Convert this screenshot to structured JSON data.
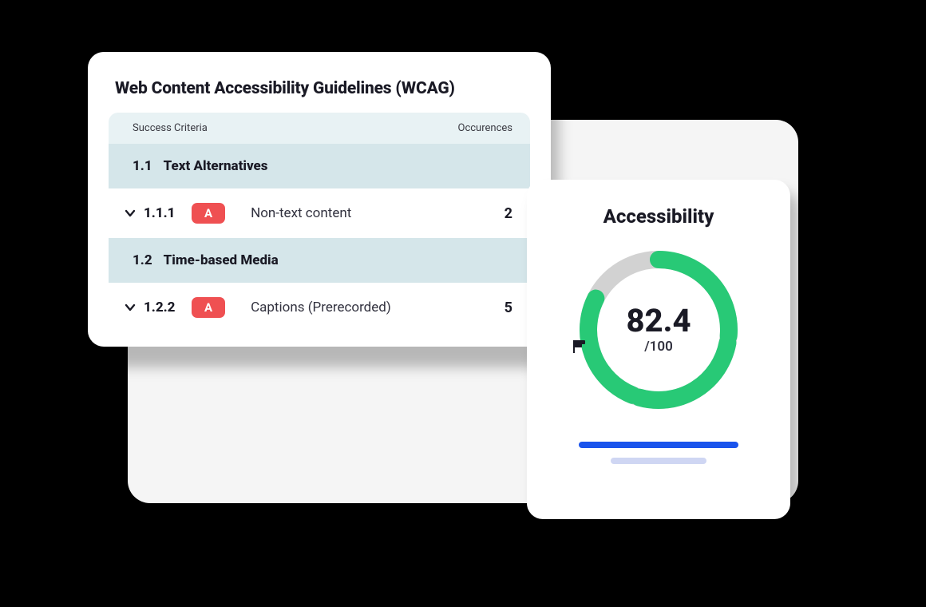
{
  "wcag": {
    "title": "Web Content Accessibility Guidelines (WCAG)",
    "columns": {
      "criteria": "Success Criteria",
      "occurrences": "Occurences"
    },
    "groups": [
      {
        "num": "1.1",
        "name": "Text Alternatives"
      },
      {
        "num": "1.2",
        "name": "Time-based Media"
      }
    ],
    "criteria": [
      {
        "num": "1.1.1",
        "level": "A",
        "name": "Non-text content",
        "count": "2"
      },
      {
        "num": "1.2.2",
        "level": "A",
        "name": "Captions (Prerecorded)",
        "count": "5"
      }
    ]
  },
  "score": {
    "title": "Accessibility",
    "value": "82.4",
    "max": "/100",
    "percent": 82.4
  },
  "colors": {
    "green": "#28c976",
    "track": "#d2d2d2",
    "badge_red": "#ef5052",
    "bar_blue": "#1a54ec",
    "bar_light": "#cfd6f3"
  }
}
